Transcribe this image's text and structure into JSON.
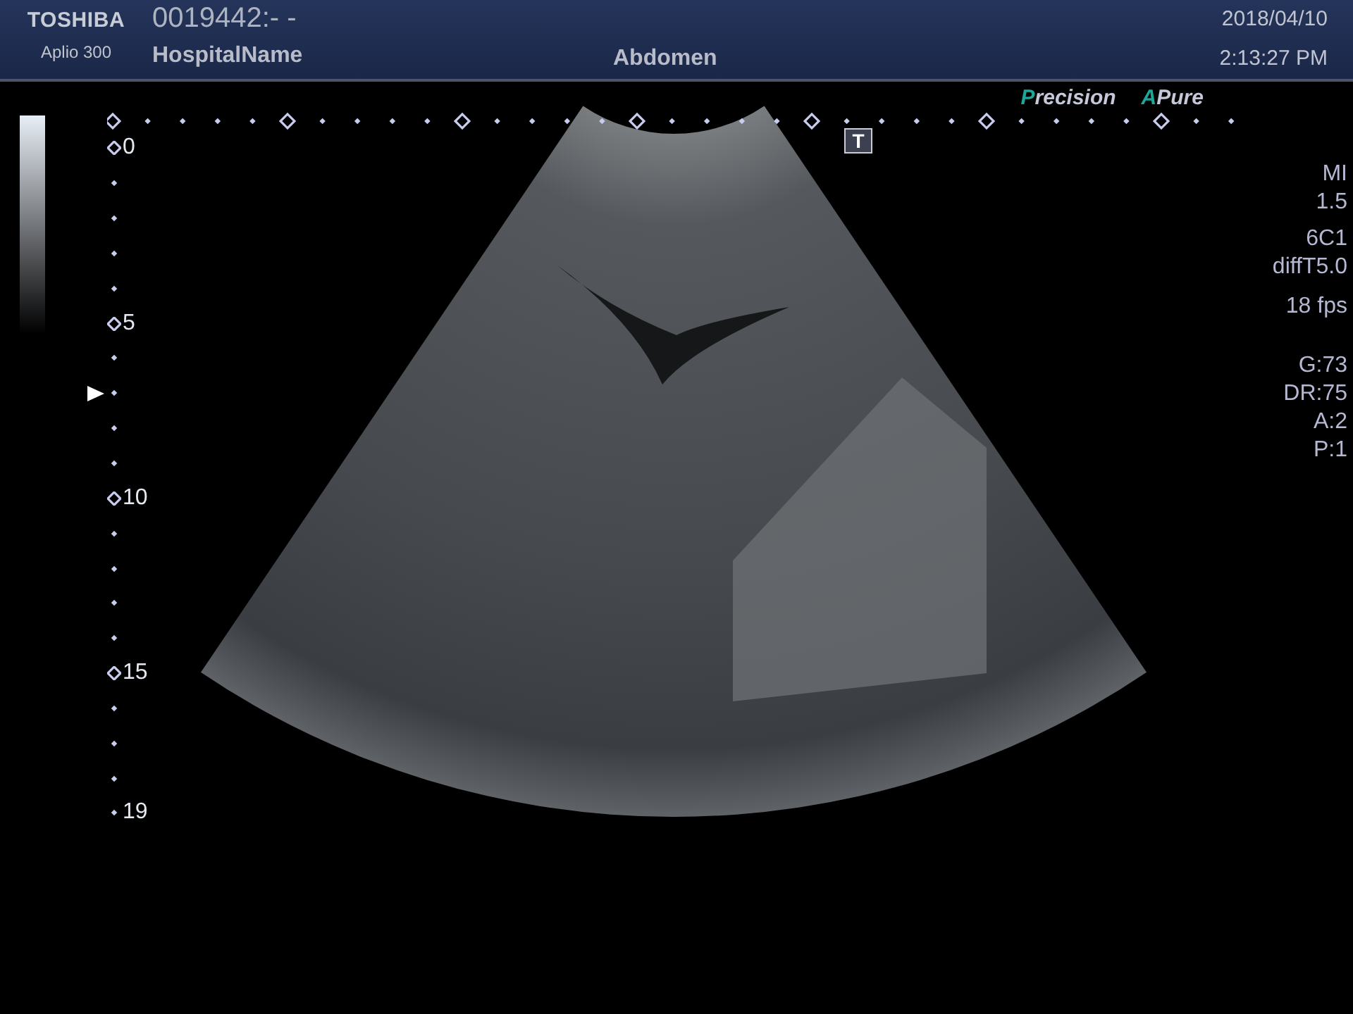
{
  "header": {
    "brand": "TOSHIBA",
    "model": "Aplio 300",
    "patient_id": "0019442:- -",
    "hospital": "HospitalName",
    "exam": "Abdomen",
    "date": "2018/04/10",
    "time": "2:13:27 PM"
  },
  "image_modes": [
    {
      "initial": "P",
      "rest": "recision"
    },
    {
      "initial": "A",
      "rest": "Pure"
    }
  ],
  "transducer_marker": "T",
  "depth_labels": [
    "0",
    "5",
    "10",
    "15",
    "19"
  ],
  "parameter_groups": [
    [
      "MI",
      "1.5"
    ],
    [
      "6C1",
      "diffT5.0"
    ],
    [
      "18 fps"
    ],
    [
      "G:73",
      "DR:75",
      "A:2",
      "P:1"
    ]
  ]
}
